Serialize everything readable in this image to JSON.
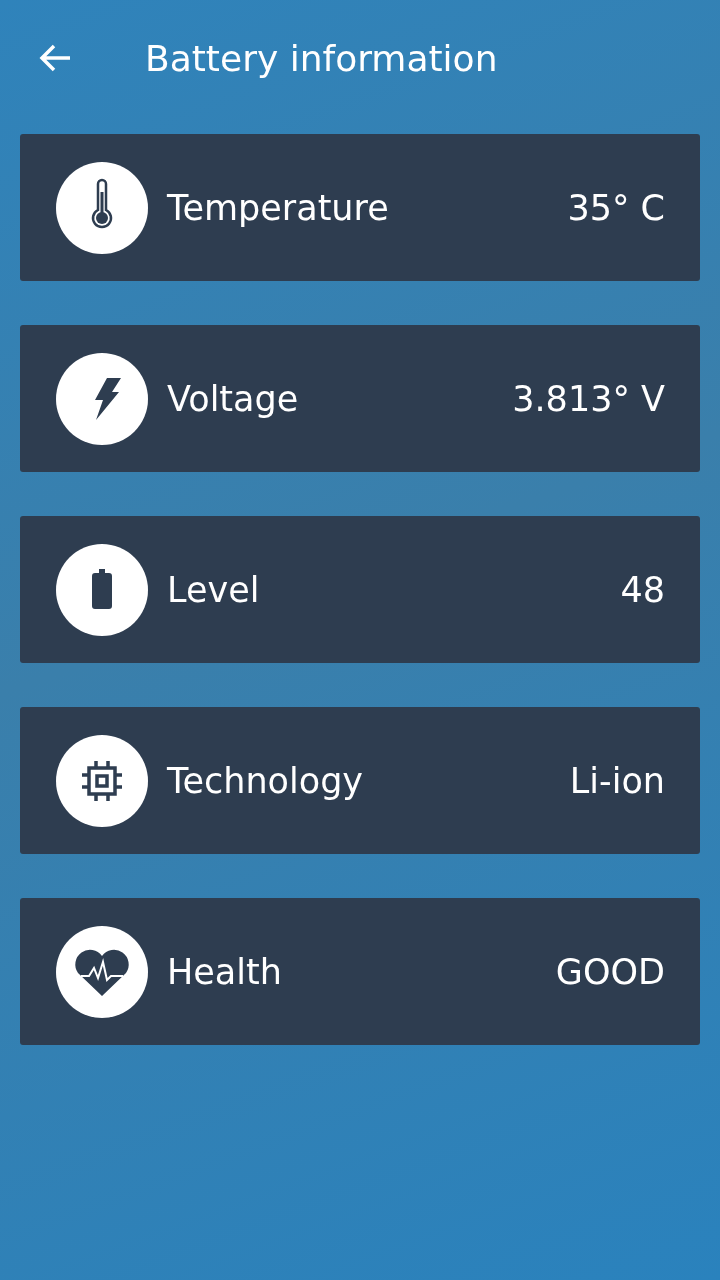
{
  "header": {
    "title": "Battery information"
  },
  "items": [
    {
      "kind": "thermometer",
      "label": "Temperature",
      "value": "35° C"
    },
    {
      "kind": "bolt",
      "label": "Voltage",
      "value": "3.813° V"
    },
    {
      "kind": "battery",
      "label": "Level",
      "value": "48"
    },
    {
      "kind": "chip",
      "label": "Technology",
      "value": "Li-ion"
    },
    {
      "kind": "heart",
      "label": "Health",
      "value": "GOOD"
    }
  ]
}
